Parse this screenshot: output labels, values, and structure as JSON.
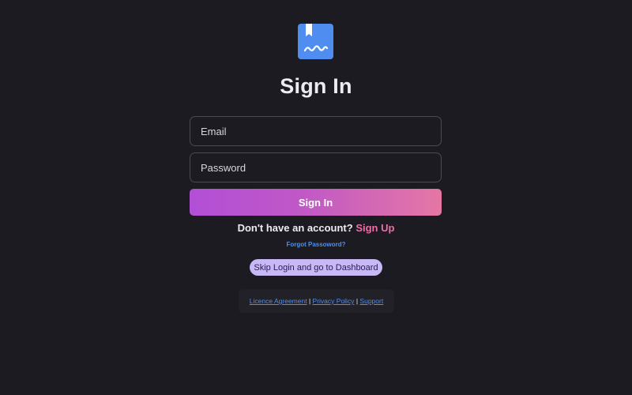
{
  "logo": {
    "icon": "bookmark-signature-icon",
    "color": "#4f8ef0"
  },
  "title": "Sign In",
  "form": {
    "email_placeholder": "Email",
    "password_placeholder": "Password",
    "submit_label": "Sign In"
  },
  "signup": {
    "prompt": "Don't have an account?",
    "link_label": "Sign Up"
  },
  "forgot_password_label": "Forgot Passoword?",
  "skip_label": "Skip Login and go to Dashboard",
  "footer": {
    "licence_label": "Licence Agreement",
    "privacy_label": "Privacy Policy",
    "support_label": "Support",
    "separator": "|"
  },
  "colors": {
    "background": "#1c1b22",
    "accent_blue": "#4f8ef0",
    "accent_pink": "#ec6fa8",
    "button_gradient_start": "#b24fd6",
    "button_gradient_end": "#e577a4",
    "skip_button": "#c8b8f6"
  }
}
